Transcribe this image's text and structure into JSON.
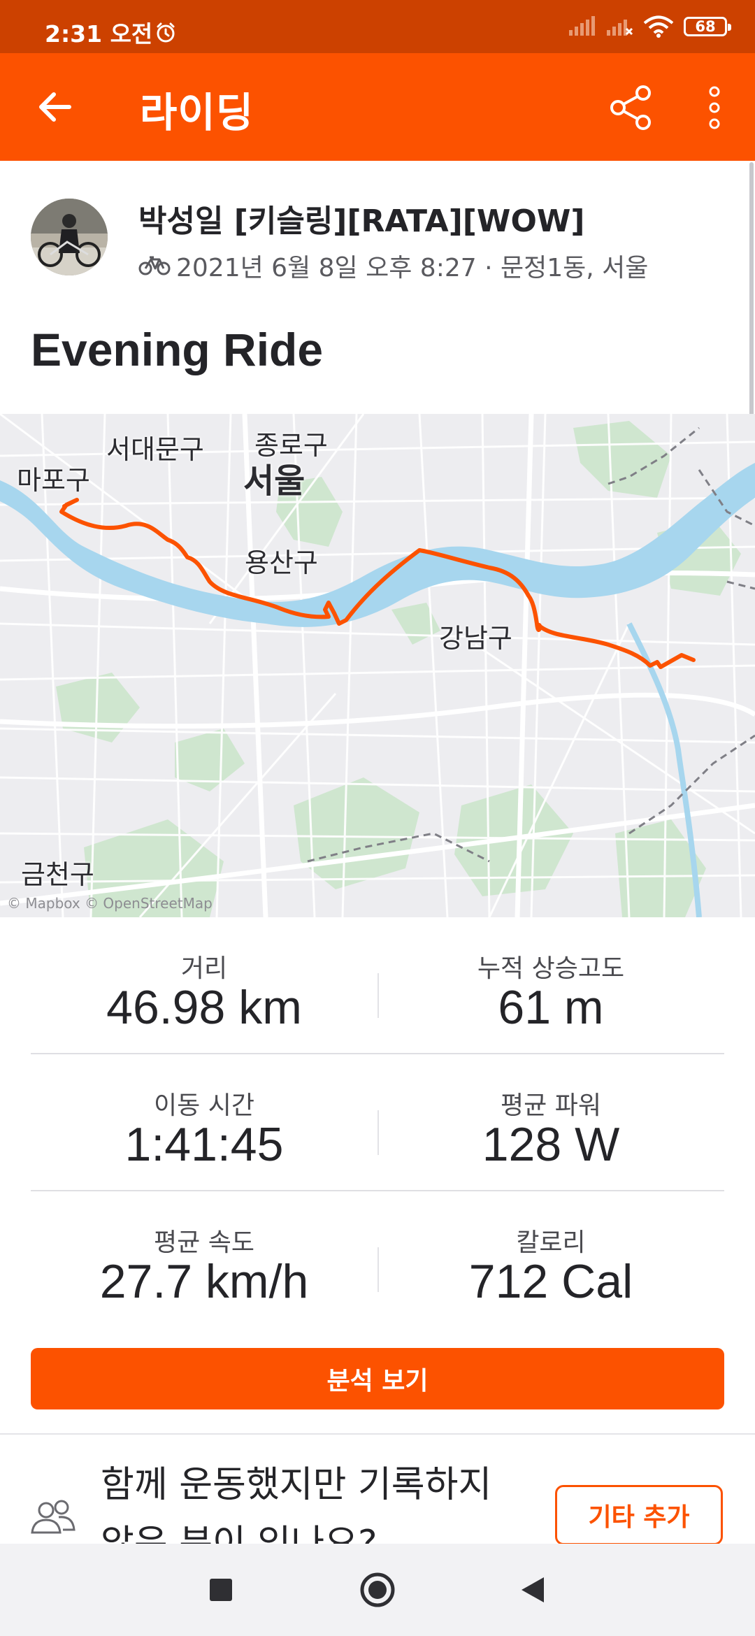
{
  "status_bar": {
    "time": "2:31 오전",
    "battery": "68",
    "icons": [
      "alarm-icon",
      "signal-icon",
      "signal-off-icon",
      "wifi-icon",
      "battery-icon"
    ]
  },
  "app_bar": {
    "title": "라이딩",
    "icons": [
      "back-arrow-icon",
      "share-icon",
      "more-vert-icon"
    ],
    "background": "#fc5200"
  },
  "activity": {
    "athlete_name": "박성일 [키슬링][RATA][WOW]",
    "meta": "2021년 6월 8일 오후 8:27 · 문정1동, 서울",
    "type_icon": "bicycle-icon",
    "title": "Evening Ride"
  },
  "map": {
    "labels": {
      "seodaemun": "서대문구",
      "jongno": "종로구",
      "mapo": "마포구",
      "seoul": "서울",
      "yongsan": "용산구",
      "gangnam": "강남구",
      "geumcheon": "금천구"
    },
    "attribution": "© Mapbox © OpenStreetMap",
    "route_color": "#fc5200"
  },
  "stats": [
    [
      {
        "label": "거리",
        "value": "46.98 km"
      },
      {
        "label": "누적 상승고도",
        "value": "61 m"
      }
    ],
    [
      {
        "label": "이동 시간",
        "value": "1:41:45"
      },
      {
        "label": "평균 파워",
        "value": "128 W"
      }
    ],
    [
      {
        "label": "평균 속도",
        "value": "27.7 km/h"
      },
      {
        "label": "칼로리",
        "value": "712 Cal"
      }
    ]
  ],
  "analysis_button": "분석 보기",
  "add_others": {
    "prompt": "함께 운동했지만 기록하지 않은 분이 있나요?",
    "button": "기타 추가",
    "icon": "group-icon"
  },
  "nav_bar": {
    "icons": [
      "recent-apps-icon",
      "home-icon",
      "back-icon"
    ]
  }
}
